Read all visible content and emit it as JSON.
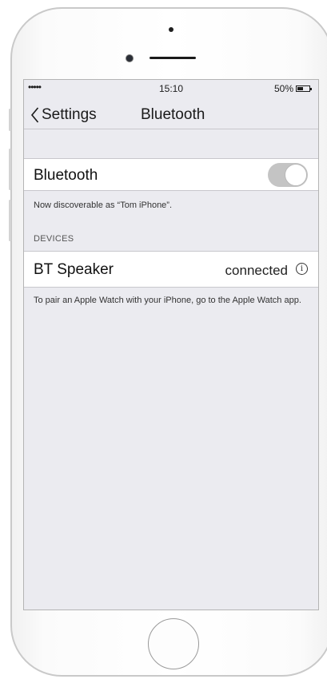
{
  "status_bar": {
    "signal": "•••••",
    "time": "15:10",
    "battery_percent": "50%",
    "battery_level": 0.5
  },
  "nav": {
    "back_label": "Settings",
    "title": "Bluetooth"
  },
  "bluetooth": {
    "label": "Bluetooth",
    "enabled": true,
    "discoverable_text": "Now discoverable as “Tom iPhone”."
  },
  "devices": {
    "header": "DEVICES",
    "items": [
      {
        "name": "BT Speaker",
        "status": "connected",
        "info_glyph": "i"
      }
    ]
  },
  "footer_note": "To pair an Apple Watch with your iPhone, go to the Apple Watch app.",
  "colors": {
    "screen_bg": "#ebebf0",
    "toggle_track": "#c4c4c4",
    "separator": "#c8c7cc"
  }
}
